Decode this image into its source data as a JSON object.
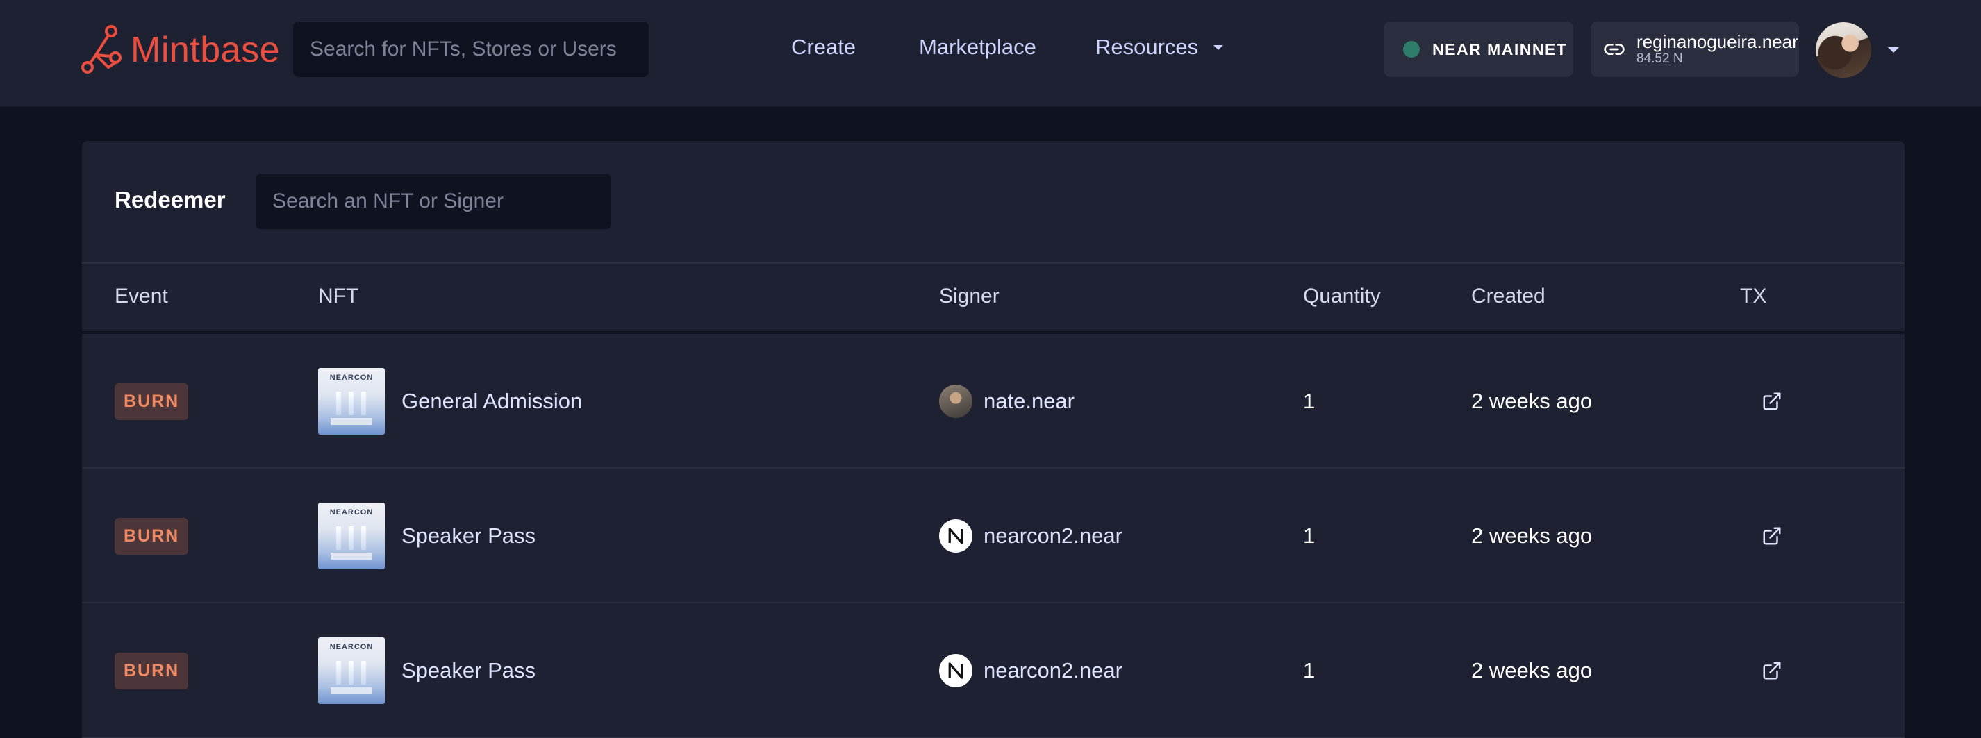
{
  "header": {
    "logo_text": "Mintbase",
    "search_placeholder": "Search for NFTs, Stores or Users",
    "nav": {
      "create": "Create",
      "marketplace": "Marketplace",
      "resources": "Resources"
    },
    "network_label": "NEAR MAINNET",
    "account_name": "reginanogueira.near",
    "account_balance": "84.52 N"
  },
  "panel": {
    "title": "Redeemer",
    "search_placeholder": "Search an NFT or Signer",
    "columns": {
      "event": "Event",
      "nft": "NFT",
      "signer": "Signer",
      "quantity": "Quantity",
      "created": "Created",
      "tx": "TX"
    },
    "rows": [
      {
        "event": "BURN",
        "nft": "General Admission",
        "signer": "nate.near",
        "signer_avatar": "photo",
        "quantity": "1",
        "created": "2 weeks ago"
      },
      {
        "event": "BURN",
        "nft": "Speaker Pass",
        "signer": "nearcon2.near",
        "signer_avatar": "near-logo",
        "quantity": "1",
        "created": "2 weeks ago"
      },
      {
        "event": "BURN",
        "nft": "Speaker Pass",
        "signer": "nearcon2.near",
        "signer_avatar": "near-logo",
        "quantity": "1",
        "created": "2 weeks ago"
      }
    ]
  },
  "colors": {
    "brand": "#ec4e3f",
    "background": "#0f1221",
    "surface": "#1e2131",
    "burn_badge_bg": "#4d3639",
    "burn_badge_text": "#f08a62",
    "network_dot": "#2e7d6a"
  },
  "icons": [
    "mintbase-logo-icon",
    "chevron-down-icon",
    "link-icon",
    "user-avatar",
    "external-link-icon",
    "near-logo-icon"
  ]
}
